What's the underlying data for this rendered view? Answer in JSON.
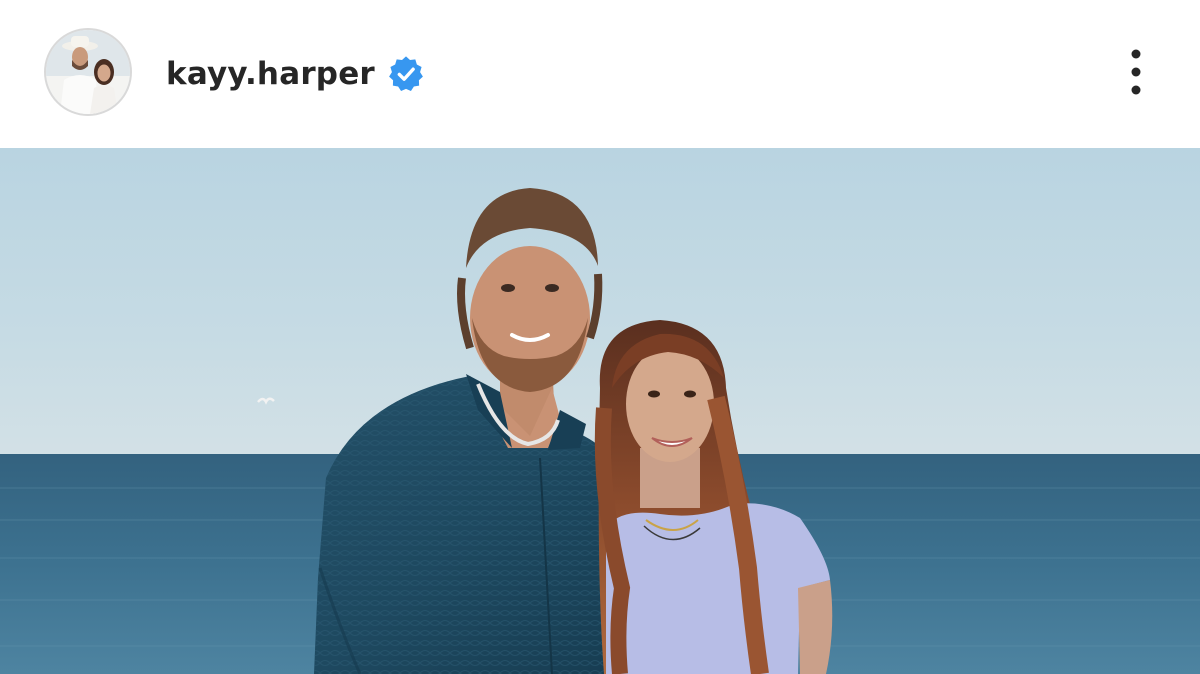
{
  "post": {
    "author": {
      "username": "kayy.harper",
      "verified": true,
      "avatar_icon": "profile-avatar",
      "verified_icon": "verified-badge-icon"
    },
    "more_icon": "more-vertical-icon",
    "photo": {
      "subject": "couple-standing-by-sea"
    }
  },
  "colors": {
    "verified_blue": "#3797f0",
    "username_text": "#262626",
    "sky_top": "#bcd6e3",
    "sea": "#3b6d8c"
  }
}
